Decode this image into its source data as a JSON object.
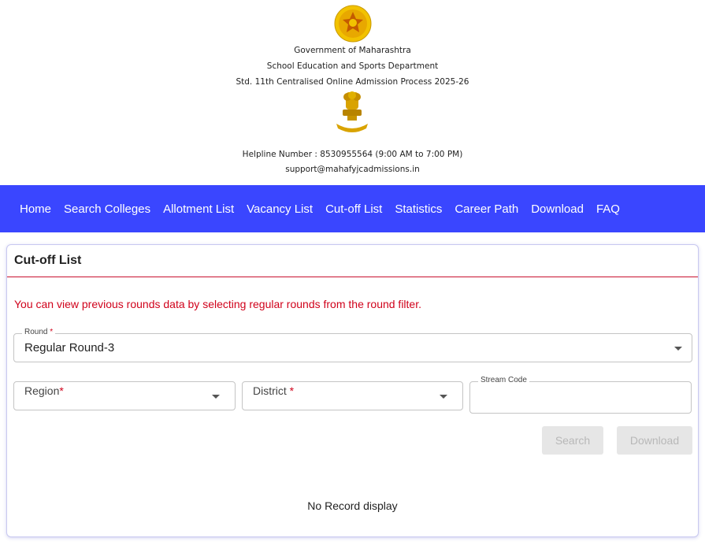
{
  "header": {
    "org": "Government of Maharashtra",
    "dept": "School Education and Sports Department",
    "process": "Std. 11th Centralised Online Admission Process 2025-26",
    "helpline": "Helpline Number : 8530955564 (9:00 AM to 7:00 PM)",
    "email": "support@mahafyjcadmissions.in"
  },
  "nav": {
    "items": [
      "Home",
      "Search Colleges",
      "Allotment List",
      "Vacancy List",
      "Cut-off List",
      "Statistics",
      "Career Path",
      "Download",
      "FAQ"
    ]
  },
  "card": {
    "title": "Cut-off List",
    "notice": "You can view previous rounds data by selecting regular rounds from the round filter.",
    "round": {
      "label": "Round",
      "required": "*",
      "value": "Regular Round-3"
    },
    "region": {
      "label": "Region",
      "required": "*"
    },
    "district": {
      "label": "District",
      "required": "*"
    },
    "stream": {
      "label": "Stream Code",
      "value": ""
    },
    "search_label": "Search",
    "download_label": "Download",
    "empty_message": "No Record display"
  },
  "colors": {
    "nav_bg": "#3a46ff",
    "accent_red": "#d0021b",
    "disabled_btn": "#e6e6e6"
  }
}
